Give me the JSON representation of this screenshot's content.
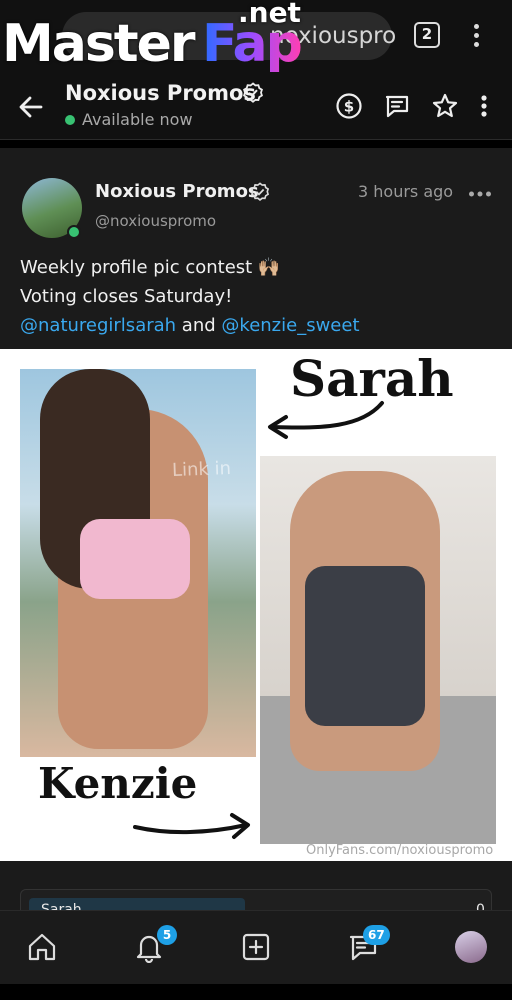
{
  "browser": {
    "url_text": "noxiouspro",
    "tab_count": "2",
    "watermark_master": "Master",
    "watermark_fap": "Fap",
    "watermark_net": ".net"
  },
  "chat_header": {
    "name": "Noxious Promos",
    "status": "Available now"
  },
  "post": {
    "author_name": "Noxious Promos",
    "handle": "@noxiouspromo",
    "time": "3 hours ago",
    "text_line1": "Weekly profile pic contest 🙌🏼",
    "text_line2": "Voting closes Saturday!",
    "mention1": "@naturegirlsarah",
    "and_text": "and",
    "mention2": "@kenzie_sweet",
    "media": {
      "label_sarah": "Sarah",
      "label_kenzie": "Kenzie",
      "link_watermark": "Link in",
      "credit": "OnlyFans.com/noxiouspromo"
    },
    "poll": {
      "option_label": "Sarah",
      "option_count": "0"
    }
  },
  "bottom_nav": {
    "notifications_badge": "5",
    "messages_badge": "67"
  },
  "colors": {
    "accent": "#1ea0e6",
    "mention": "#3aa8ee",
    "online": "#38c172",
    "background": "#1b1b1b"
  }
}
